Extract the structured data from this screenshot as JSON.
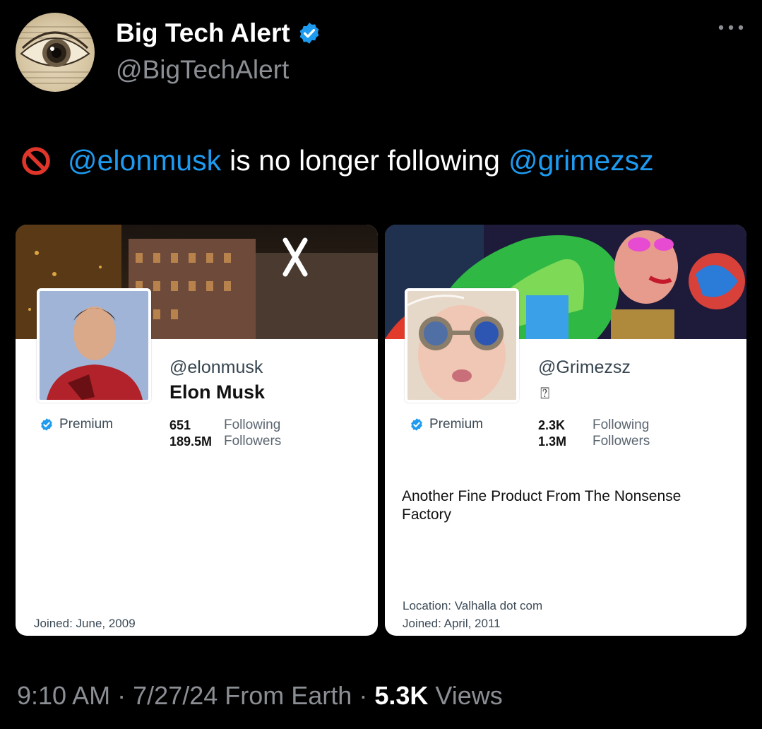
{
  "tweet": {
    "author_name": "Big Tech Alert",
    "author_handle": "@BigTechAlert",
    "mention_1": "@elonmusk",
    "body_text": "is no longer following",
    "mention_2": "@grimezsz",
    "time": "9:10 AM",
    "date": "7/27/24",
    "source": "From Earth",
    "views_count": "5.3K",
    "views_label": "Views",
    "separator": "·"
  },
  "icons": {
    "verified": "verified-badge-icon",
    "more": "more-dots-icon",
    "prohibited": "prohibited-icon",
    "premium": "premium-badge-icon"
  },
  "colors": {
    "background": "#000000",
    "mention_blue": "#1d9bf0",
    "muted_text": "#8b8f94",
    "prohibit_red": "#e0352b"
  },
  "cards": {
    "left": {
      "handle": "@elonmusk",
      "name": "Elon Musk",
      "premium_label": "Premium",
      "following_count": "651",
      "following_label": "Following",
      "followers_count": "189.5M",
      "followers_label": "Followers",
      "joined": "Joined: June, 2009"
    },
    "right": {
      "handle": "@Grimezsz",
      "name_glyph": "⍰",
      "premium_label": "Premium",
      "following_count": "2.3K",
      "following_label": "Following",
      "followers_count": "1.3M",
      "followers_label": "Followers",
      "bio": "Another Fine Product From The Nonsense Factory",
      "location": "Location: Valhalla dot com",
      "joined": "Joined: April, 2011"
    }
  }
}
